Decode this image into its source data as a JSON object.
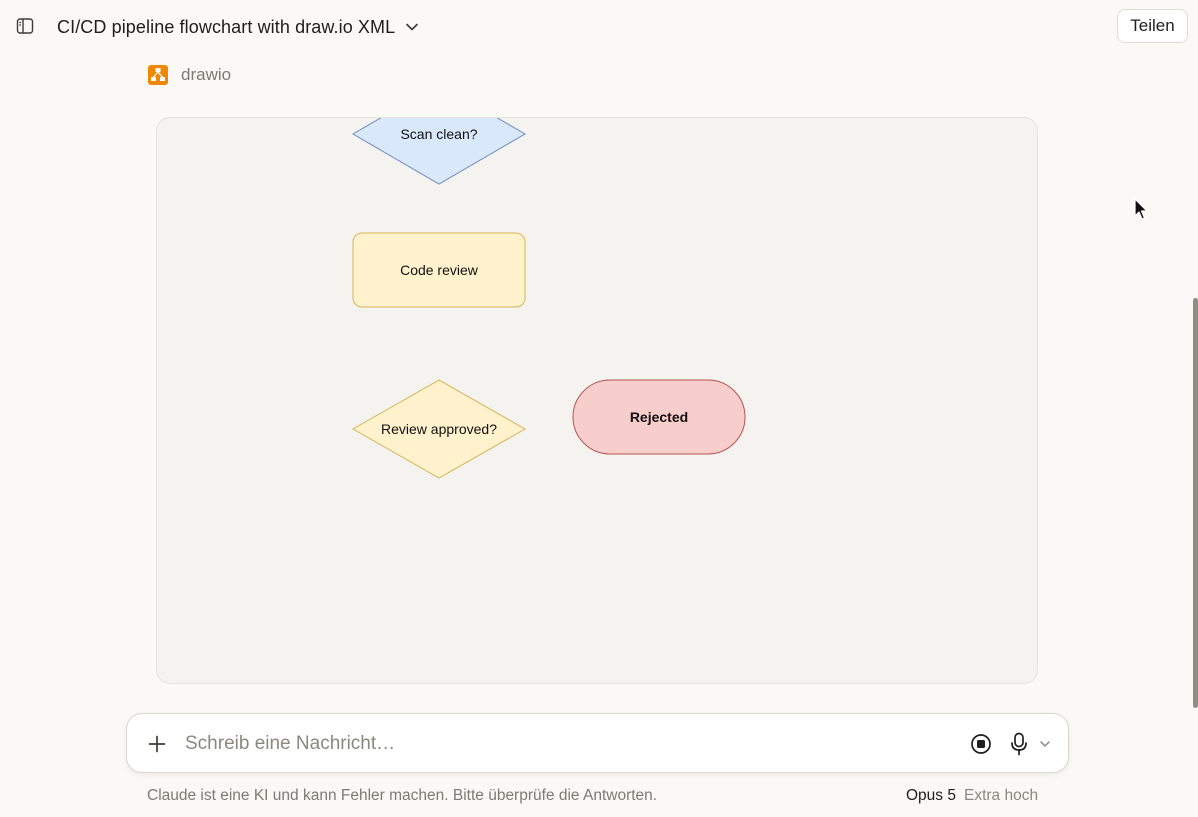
{
  "header": {
    "title": "CI/CD pipeline flowchart with draw.io XML",
    "share_label": "Teilen"
  },
  "tool": {
    "name": "drawio"
  },
  "diagram": {
    "nodes": [
      {
        "id": "scan",
        "label": "Scan clean?",
        "shape": "diamond",
        "fill": "#dae8fc",
        "stroke": "#6c8ebf"
      },
      {
        "id": "review",
        "label": "Code review",
        "shape": "rounded-rect",
        "fill": "#fff2cc",
        "stroke": "#d6b656"
      },
      {
        "id": "approved",
        "label": "Review approved?",
        "shape": "diamond",
        "fill": "#fff2cc",
        "stroke": "#d6b656"
      },
      {
        "id": "rejected",
        "label": "Rejected",
        "shape": "terminator",
        "fill": "#f8cecc",
        "stroke": "#b85450"
      }
    ]
  },
  "composer": {
    "placeholder": "Schreib eine Nachricht…"
  },
  "footer": {
    "disclaimer": "Claude ist eine KI und kann Fehler machen. Bitte überprüfe die Antworten.",
    "model": "Opus 5",
    "effort": "Extra hoch"
  },
  "icons": {
    "sidebar": "sidebar-toggle-icon",
    "title_dropdown": "chevron-down-icon",
    "tool": "drawio-logo-icon",
    "plus": "plus-icon",
    "stop": "stop-icon",
    "mic": "microphone-icon",
    "mic_dropdown": "chevron-down-icon"
  }
}
